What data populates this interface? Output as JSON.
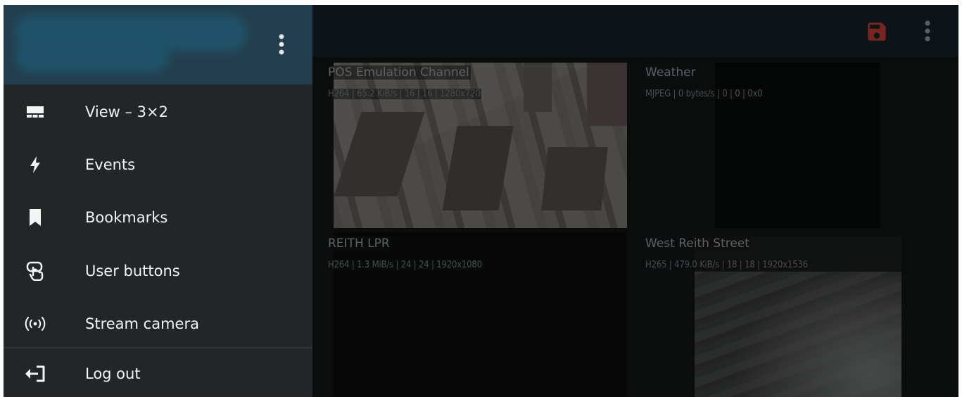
{
  "app_bar": {
    "save_icon": "save-icon",
    "more_icon": "more-vert-icon",
    "save_color": "#b73a2f"
  },
  "drawer": {
    "header_color": "#233f4f",
    "menu_icon": "more-vert-icon",
    "items": [
      {
        "label": "View – 3×2",
        "icon": "grid-view-icon"
      },
      {
        "label": "Events",
        "icon": "lightning-icon"
      },
      {
        "label": "Bookmarks",
        "icon": "bookmark-icon"
      },
      {
        "label": "User buttons",
        "icon": "touch-button-icon"
      },
      {
        "label": "Stream camera",
        "icon": "broadcast-icon"
      }
    ],
    "footer_item": {
      "label": "Log out",
      "icon": "logout-icon"
    }
  },
  "cameras": [
    {
      "name": "POS Emulation Channel",
      "meta": "H264 | 65.2 KiB/s | 16 | 16 | 1280x720"
    },
    {
      "name": "Weather",
      "meta": "MJPEG | 0 bytes/s | 0 | 0 | 0x0"
    },
    {
      "name": "REITH LPR",
      "meta": "H264 | 1.3 MiB/s | 24 | 24 | 1920x1080"
    },
    {
      "name": "West Reith Street",
      "meta": "H265 | 479.0 KiB/s | 18 | 18 | 1920x1536"
    }
  ]
}
